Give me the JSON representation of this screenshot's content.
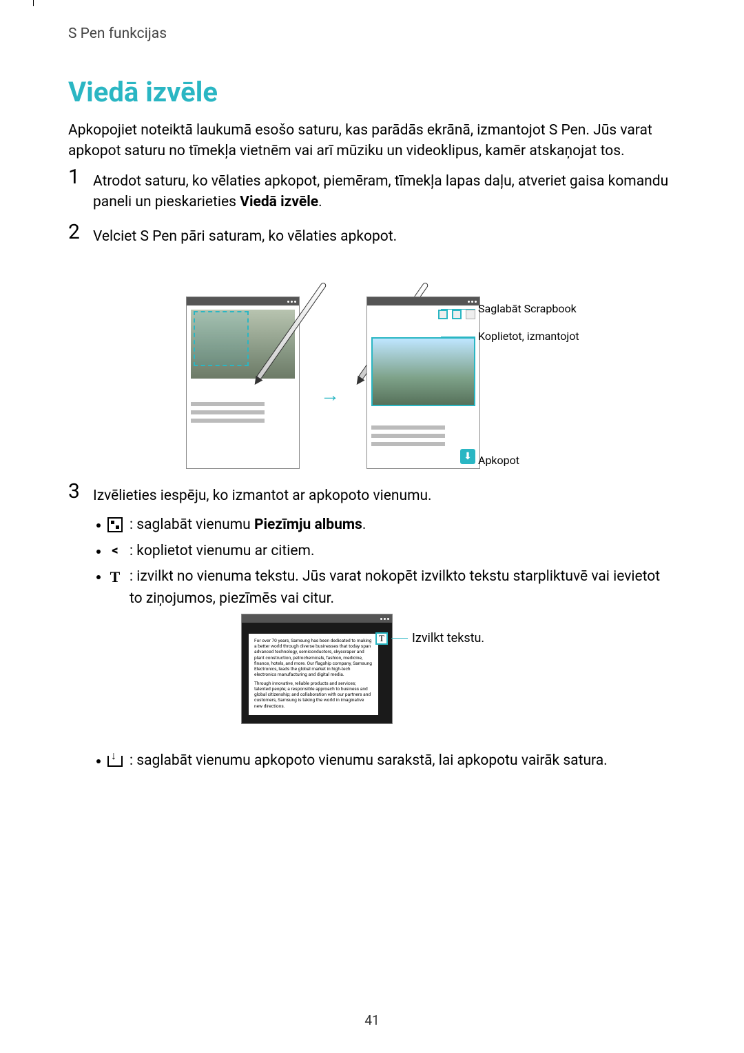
{
  "header": {
    "section": "S Pen funkcijas"
  },
  "title": "Viedā izvēle",
  "intro": "Apkopojiet noteiktā laukumā esošo saturu, kas parādās ekrānā, izmantojot S Pen. Jūs varat apkopot saturu no tīmekļa vietnēm vai arī mūziku un videoklipus, kamēr atskaņojat tos.",
  "steps": {
    "s1_num": "1",
    "s1_a": "Atrodot saturu, ko vēlaties apkopot, piemēram, tīmekļa lapas daļu, atveriet gaisa komandu paneli un pieskarieties ",
    "s1_b": "Viedā izvēle",
    "s2_num": "2",
    "s2_a": "Velciet S Pen pāri saturam, ko vēlaties apkopot.",
    "s3_num": "3",
    "s3_a": "Izvēlieties iespēju, ko izmantot ar apkopoto vienumu."
  },
  "callouts1": {
    "save_scrapbook": "Saglabāt Scrapbook",
    "share_using": "Koplietot, izmantojot",
    "collect": "Apkopot"
  },
  "bullets": {
    "b1_a": " : saglabāt vienumu ",
    "b1_b": "Piezīmju albums",
    "b2": " : koplietot vienumu ar citiem.",
    "b3": " : izvilkt no vienuma tekstu. Jūs varat nokopēt izvilkto tekstu starpliktuvē vai ievietot to ziņojumos, piezīmēs vai citur.",
    "b4": " : saglabāt vienumu apkopoto vienumu sarakstā, lai apkopotu vairāk satura."
  },
  "diagram2": {
    "callout": "Izvilkt tekstu.",
    "sample_text_1": "For over 70 years, Samsung has been dedicated to making a better world through diverse businesses that today span advanced technology, semiconductors, skyscraper and plant construction, petrochemicals, fashion, medicine, finance, hotels, and more. Our flagship company, Samsung Electronics, leads the global market in high-tech electronics manufacturing and digital media.",
    "sample_text_2": "Through innovative, reliable products and services; talented people; a responsible approach to business and global citizenship; and collaboration with our partners and customers, Samsung is taking the world in imaginative new directions."
  },
  "page_number": "41",
  "icons": {
    "scrapbook": "scrapbook-icon",
    "share": "share-icon",
    "text": "text-extract-icon",
    "download": "download-tray-icon"
  }
}
